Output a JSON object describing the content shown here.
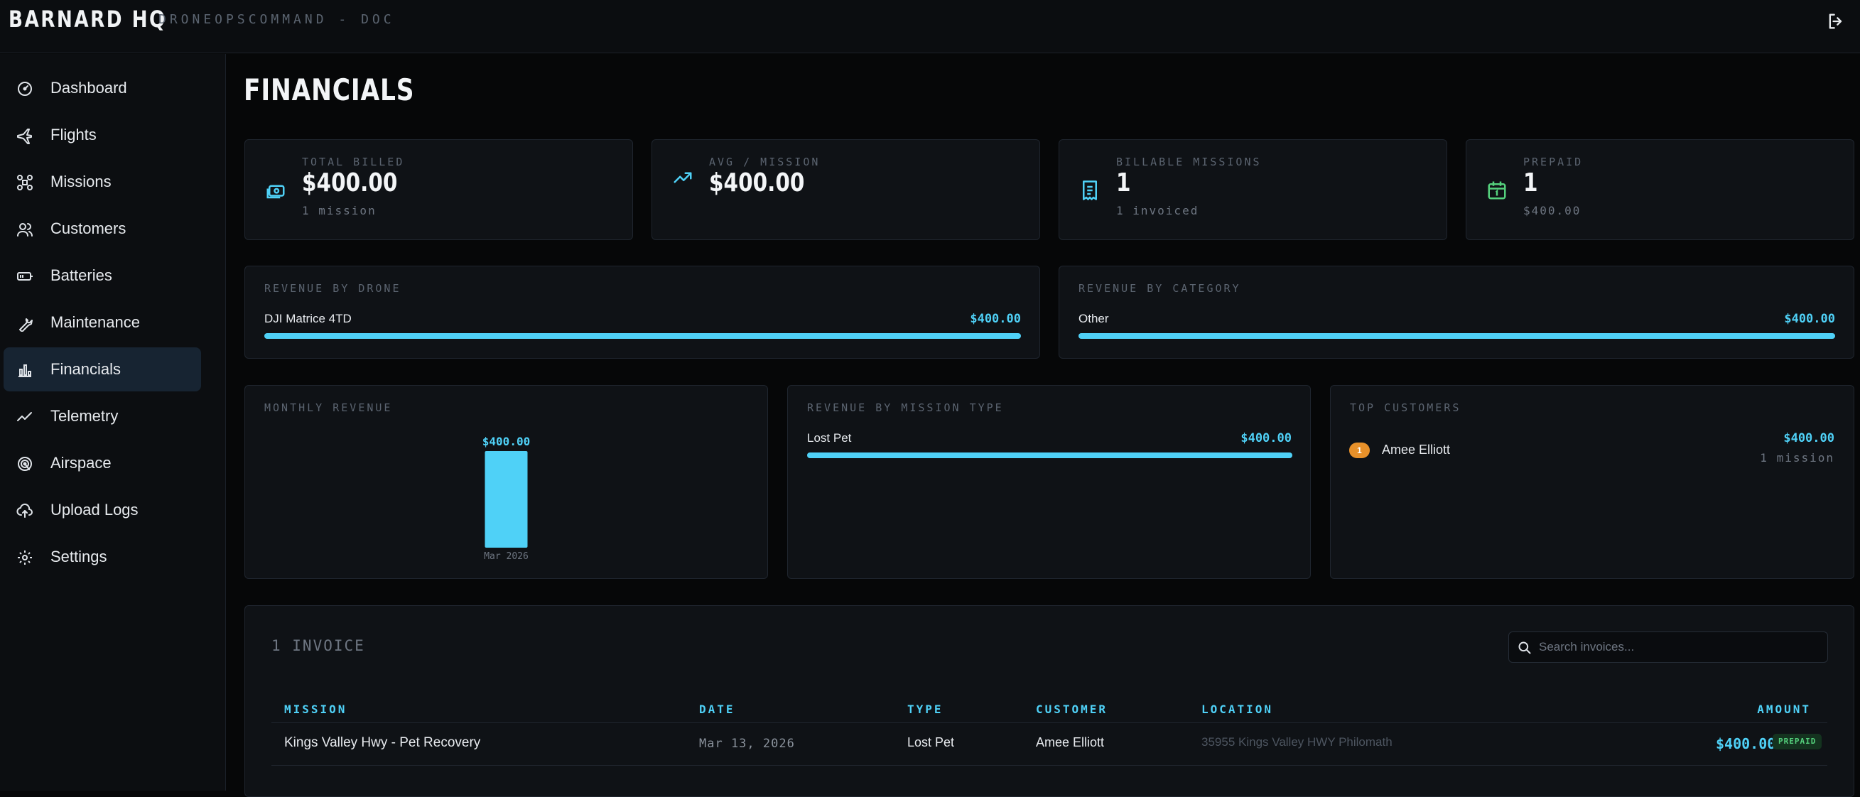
{
  "app": {
    "brand": "BARNARD HQ",
    "subtitle": "DRONEOPSCOMMAND - DOC"
  },
  "sidebar": {
    "items": [
      {
        "label": "Dashboard",
        "icon": "gauge-icon",
        "active": false
      },
      {
        "label": "Flights",
        "icon": "plane-icon",
        "active": false
      },
      {
        "label": "Missions",
        "icon": "drone-icon",
        "active": false
      },
      {
        "label": "Customers",
        "icon": "users-icon",
        "active": false
      },
      {
        "label": "Batteries",
        "icon": "battery-icon",
        "active": false
      },
      {
        "label": "Maintenance",
        "icon": "wrench-icon",
        "active": false
      },
      {
        "label": "Financials",
        "icon": "bar-chart-icon",
        "active": true
      },
      {
        "label": "Telemetry",
        "icon": "activity-icon",
        "active": false
      },
      {
        "label": "Airspace",
        "icon": "radar-icon",
        "active": false
      },
      {
        "label": "Upload Logs",
        "icon": "cloud-upload-icon",
        "active": false
      },
      {
        "label": "Settings",
        "icon": "gear-icon",
        "active": false
      }
    ]
  },
  "page": {
    "title": "FINANCIALS"
  },
  "stats": [
    {
      "label": "TOTAL BILLED",
      "value": "$400.00",
      "sub": "1 mission",
      "icon": "money-icon",
      "color": "#4fd1f7"
    },
    {
      "label": "AVG / MISSION",
      "value": "$400.00",
      "sub": "",
      "icon": "trending-up-icon",
      "color": "#4fd1f7"
    },
    {
      "label": "BILLABLE MISSIONS",
      "value": "1",
      "sub": "1 invoiced",
      "icon": "receipt-icon",
      "color": "#4fd1f7"
    },
    {
      "label": "PREPAID",
      "value": "1",
      "sub": "$400.00",
      "icon": "calendar-icon",
      "color": "#55d17d"
    }
  ],
  "revenue_by_drone": {
    "label": "REVENUE BY DRONE",
    "items": [
      {
        "name": "DJI Matrice 4TD",
        "value": "$400.00",
        "fraction": 1.0
      }
    ]
  },
  "revenue_by_category": {
    "label": "REVENUE BY CATEGORY",
    "items": [
      {
        "name": "Other",
        "value": "$400.00",
        "fraction": 1.0
      }
    ]
  },
  "monthly_revenue": {
    "label": "MONTHLY REVENUE",
    "bar_label": "$400.00",
    "month": "Mar 2026"
  },
  "chart_data": {
    "type": "bar",
    "categories": [
      "Mar 2026"
    ],
    "values": [
      400
    ],
    "title": "MONTHLY REVENUE",
    "xlabel": "",
    "ylabel": "",
    "ylim": [
      0,
      400
    ]
  },
  "revenue_by_mission_type": {
    "label": "REVENUE BY MISSION TYPE",
    "items": [
      {
        "name": "Lost Pet",
        "value": "$400.00",
        "fraction": 1.0
      }
    ]
  },
  "top_customers": {
    "label": "TOP CUSTOMERS",
    "items": [
      {
        "rank": "1",
        "name": "Amee Elliott",
        "value": "$400.00",
        "sub": "1 mission"
      }
    ]
  },
  "invoices": {
    "count_label": "1 INVOICE",
    "search_placeholder": "Search invoices...",
    "columns": {
      "mission": "MISSION",
      "date": "DATE",
      "type": "TYPE",
      "customer": "CUSTOMER",
      "location": "LOCATION",
      "amount": "AMOUNT"
    },
    "rows": [
      {
        "mission": "Kings Valley Hwy - Pet Recovery",
        "date": "Mar 13, 2026",
        "type": "Lost Pet",
        "customer": "Amee Elliott",
        "location": "35955 Kings Valley HWY Philomath",
        "amount": "$400.00",
        "status": "PREPAID"
      }
    ]
  }
}
